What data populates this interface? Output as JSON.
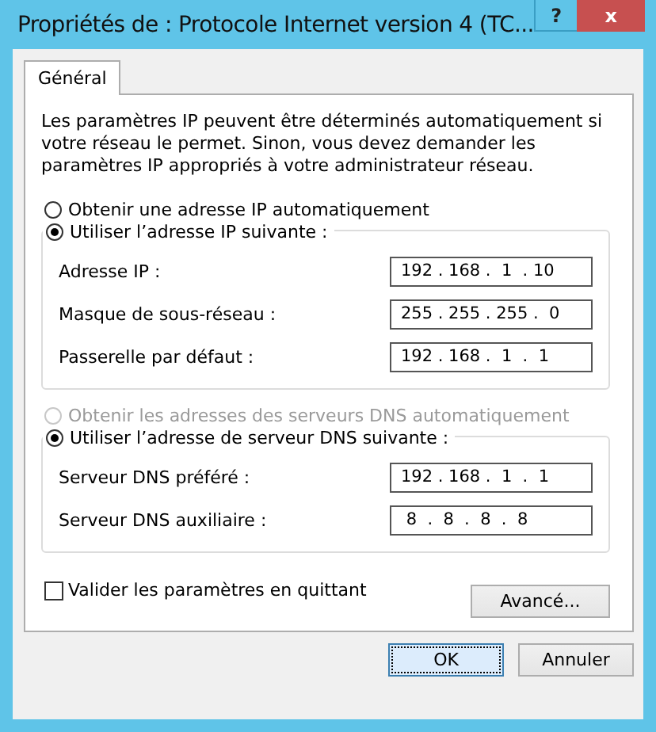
{
  "window": {
    "title": "Propriétés de : Protocole Internet version 4 (TC...",
    "help": "?",
    "close": "x"
  },
  "tabs": [
    {
      "label": "Général",
      "selected": true
    }
  ],
  "intro": "Les paramètres IP peuvent être déterminés automatiquement si votre réseau le permet. Sinon, vous devez demander les paramètres IP appropriés à votre administrateur réseau.",
  "sections": [
    {
      "auto_option": {
        "label": "Obtenir une adresse IP automatiquement",
        "selected": false,
        "disabled": false
      },
      "manual_option": {
        "label": "Utiliser l’adresse IP suivante :",
        "selected": true,
        "disabled": false
      },
      "fields": [
        {
          "label": "Adresse IP :",
          "value": "192 . 168 .  1  . 10"
        },
        {
          "label": "Masque de sous-réseau :",
          "value": "255 . 255 . 255 .  0"
        },
        {
          "label": "Passerelle par défaut :",
          "value": "192 . 168 .  1  .  1"
        }
      ]
    },
    {
      "auto_option": {
        "label": "Obtenir les adresses des serveurs DNS automatiquement",
        "selected": false,
        "disabled": true
      },
      "manual_option": {
        "label": "Utiliser l’adresse de serveur DNS suivante :",
        "selected": true,
        "disabled": false
      },
      "fields": [
        {
          "label": "Serveur DNS préféré :",
          "value": "192 . 168 .  1  .  1"
        },
        {
          "label": "Serveur DNS auxiliaire :",
          "value": " 8  .  8  .  8  .  8"
        }
      ]
    }
  ],
  "validate": {
    "label": "Valider les paramètres en quittant",
    "checked": false
  },
  "advanced_button": "Avancé...",
  "buttons": [
    {
      "label": "OK",
      "default": true
    },
    {
      "label": "Annuler",
      "default": false
    }
  ]
}
